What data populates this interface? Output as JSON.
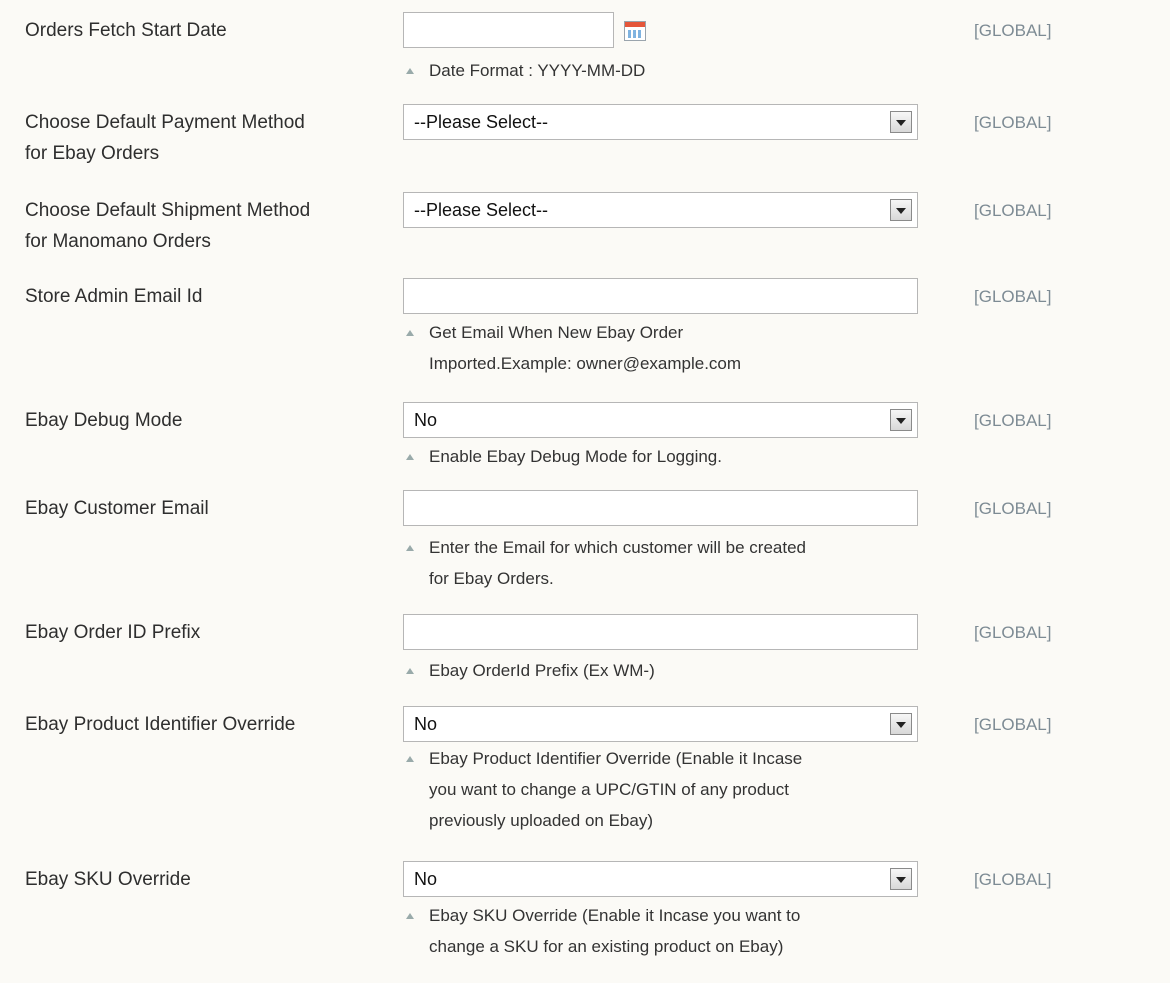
{
  "scope_label": "[GLOBAL]",
  "rows": [
    {
      "label": "Orders Fetch Start Date",
      "input_value": "",
      "note": "Date Format : YYYY-MM-DD"
    },
    {
      "label_line1": "Choose Default Payment Method",
      "label_line2": "for Ebay Orders",
      "selected": "--Please Select--"
    },
    {
      "label_line1": "Choose Default Shipment Method",
      "label_line2": "for Manomano Orders",
      "selected": "--Please Select--"
    },
    {
      "label": "Store Admin Email Id",
      "input_value": "",
      "note_line1": "Get Email When New Ebay Order",
      "note_line2": "Imported.Example: owner@example.com"
    },
    {
      "label": "Ebay Debug Mode",
      "selected": "No",
      "note": "Enable Ebay Debug Mode for Logging."
    },
    {
      "label": "Ebay Customer Email",
      "input_value": "",
      "note_line1": "Enter the Email for which customer will be created",
      "note_line2": "for Ebay Orders."
    },
    {
      "label": "Ebay Order ID Prefix",
      "input_value": "",
      "note": "Ebay OrderId Prefix (Ex WM-)"
    },
    {
      "label": "Ebay Product Identifier Override",
      "selected": "No",
      "note_line1": "Ebay Product Identifier Override (Enable it Incase",
      "note_line2": "you want to change a UPC/GTIN of any product",
      "note_line3": "previously uploaded on Ebay)"
    },
    {
      "label": "Ebay SKU Override",
      "selected": "No",
      "note_line1": "Ebay SKU Override (Enable it Incase you want to",
      "note_line2": "change a SKU for an existing product on Ebay)"
    }
  ],
  "icons": {
    "calendar": "calendar-icon",
    "dropdown": "chevron-down-icon",
    "note": "triangle-up-icon"
  }
}
